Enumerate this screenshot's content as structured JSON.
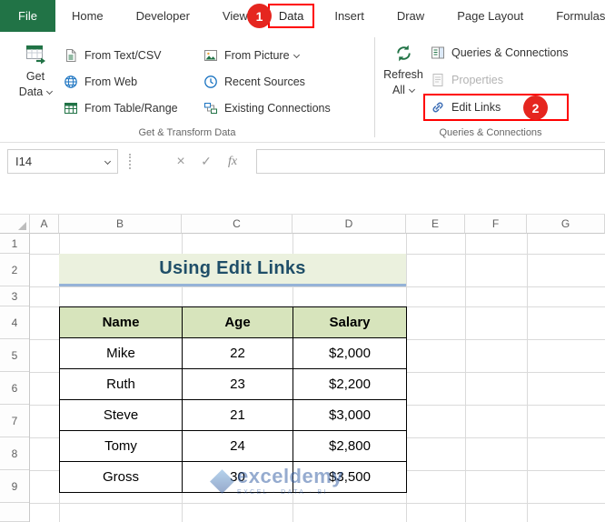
{
  "colors": {
    "excel_green": "#217346",
    "annotation_red": "#FF0000",
    "circle_red": "#E5261F",
    "title_text": "#1F4E68",
    "title_bg": "#EBF1DE",
    "title_underline": "#95B3D7",
    "table_header_bg": "#D7E4BC",
    "watermark_blue": "#2E5AA0"
  },
  "annotations": {
    "step1": "1",
    "step2": "2"
  },
  "tabs": {
    "items": [
      "File",
      "Home",
      "Developer",
      "View",
      "Data",
      "Insert",
      "Draw",
      "Page Layout",
      "Formulas"
    ]
  },
  "ribbon": {
    "get_data": {
      "line1": "Get",
      "line2": "Data"
    },
    "transform_group": {
      "buttons_col1": [
        "From Text/CSV",
        "From Web",
        "From Table/Range"
      ],
      "buttons_col2": [
        "From Picture",
        "Recent Sources",
        "Existing Connections"
      ],
      "label": "Get & Transform Data"
    },
    "refresh": {
      "line1": "Refresh",
      "line2": "All"
    },
    "connections_group": {
      "queries": "Queries & Connections",
      "properties": "Properties",
      "edit_links": "Edit Links",
      "label": "Queries & Connections"
    }
  },
  "formula_bar": {
    "name_box": "I14",
    "cancel": "×",
    "check": "✓",
    "fx": "fx"
  },
  "sheet": {
    "column_headers": [
      "A",
      "B",
      "C",
      "D",
      "E",
      "F",
      "G"
    ],
    "row_headers": [
      "1",
      "2",
      "3",
      "4",
      "5",
      "6",
      "7",
      "8",
      "9"
    ],
    "title": "Using Edit Links",
    "table": {
      "headers": [
        "Name",
        "Age",
        "Salary"
      ],
      "rows": [
        [
          "Mike",
          "22",
          "$2,000"
        ],
        [
          "Ruth",
          "23",
          "$2,200"
        ],
        [
          "Steve",
          "21",
          "$3,000"
        ],
        [
          "Tomy",
          "24",
          "$2,800"
        ],
        [
          "Gross",
          "30",
          "$3,500"
        ]
      ]
    }
  },
  "watermark": {
    "brand": "exceldemy",
    "tagline": "EXCEL · DATA · BI"
  }
}
